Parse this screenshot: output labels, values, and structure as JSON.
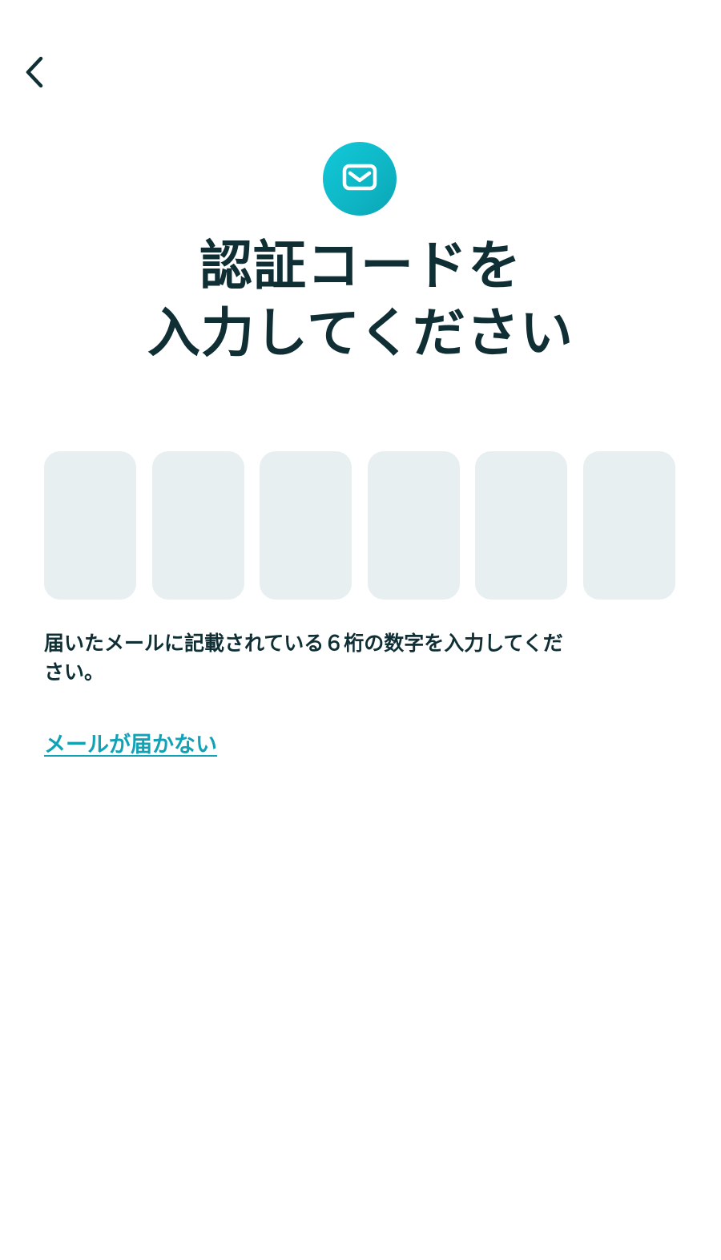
{
  "header": {
    "back_icon": "chevron-left-icon"
  },
  "badge": {
    "icon": "mail-icon",
    "color": "#10c0d0"
  },
  "title": {
    "line1": "認証コードを",
    "line2": "入力してください"
  },
  "code_input": {
    "length": 6,
    "cells": [
      "",
      "",
      "",
      "",
      "",
      ""
    ]
  },
  "instruction": "届いたメールに記載されている６桁の数字を入力してください。",
  "resend_link": "メールが届かない",
  "colors": {
    "text": "#0f2f35",
    "accent": "#12a2b6",
    "cell_background": "#e7eff1"
  }
}
